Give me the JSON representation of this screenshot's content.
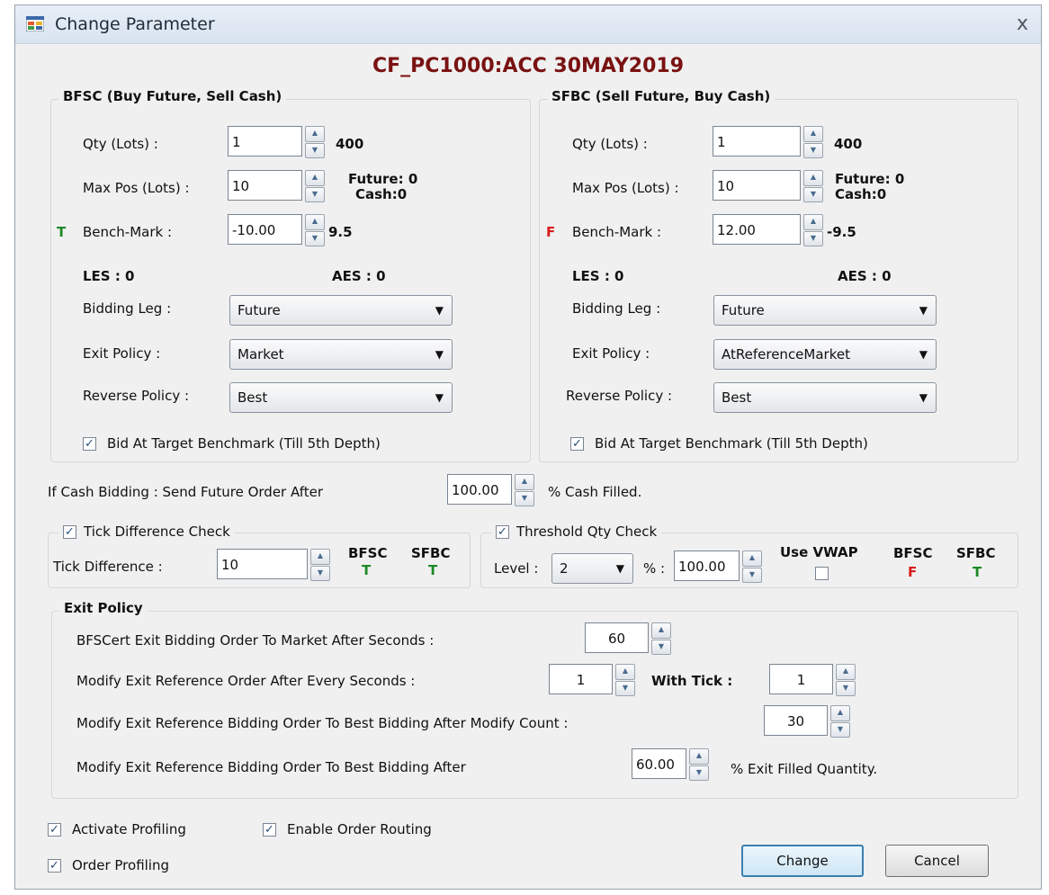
{
  "window": {
    "title": "Change Parameter",
    "close": "x"
  },
  "heading": "CF_PC1000:ACC 30MAY2019",
  "bfsc": {
    "legend": "BFSC (Buy Future, Sell Cash)",
    "qty_label": "Qty (Lots) :",
    "qty_value": "1",
    "qty_info": "400",
    "maxpos_label": "Max Pos (Lots) :",
    "maxpos_value": "10",
    "future_info": "Future: 0",
    "cash_info": "Cash:0",
    "flag": "T",
    "benchmark_label": "Bench-Mark :",
    "benchmark_value": "-10.00",
    "benchmark_info": "9.5",
    "les": "LES : 0",
    "aes": "AES : 0",
    "bidding_leg_label": "Bidding Leg :",
    "bidding_leg_value": "Future",
    "exit_policy_label": "Exit Policy :",
    "exit_policy_value": "Market",
    "reverse_policy_label": "Reverse Policy :",
    "reverse_policy_value": "Best",
    "bid_target_label": "Bid At Target Benchmark (Till 5th Depth)"
  },
  "sfbc": {
    "legend": "SFBC (Sell Future, Buy Cash)",
    "qty_label": "Qty (Lots) :",
    "qty_value": "1",
    "qty_info": "400",
    "maxpos_label": "Max Pos (Lots) :",
    "maxpos_value": "10",
    "future_info": "Future: 0",
    "cash_info": "Cash:0",
    "flag": "F",
    "benchmark_label": "Bench-Mark :",
    "benchmark_value": "12.00",
    "benchmark_info": "-9.5",
    "les": "LES : 0",
    "aes": "AES : 0",
    "bidding_leg_label": "Bidding Leg :",
    "bidding_leg_value": "Future",
    "exit_policy_label": "Exit Policy :",
    "exit_policy_value": "AtReferenceMarket",
    "reverse_policy_label": "Reverse Policy :",
    "reverse_policy_value": "Best",
    "bid_target_label": "Bid At Target Benchmark (Till 5th Depth)"
  },
  "cash_bidding": {
    "label": "If Cash Bidding : Send Future Order After",
    "value": "100.00",
    "suffix": "% Cash Filled."
  },
  "tick_check": {
    "legend": "Tick Difference Check",
    "label": "Tick Difference :",
    "value": "10",
    "bfsc_label": "BFSC",
    "sfbc_label": "SFBC",
    "bfsc_flag": "T",
    "sfbc_flag": "T"
  },
  "threshold_check": {
    "legend": "Threshold Qty Check",
    "level_label": "Level :",
    "level_value": "2",
    "pct_label": "% :",
    "pct_value": "100.00",
    "vwap_label": "Use VWAP",
    "bfsc_label": "BFSC",
    "sfbc_label": "SFBC",
    "bfsc_flag": "F",
    "sfbc_flag": "T"
  },
  "exit_policy": {
    "legend": "Exit Policy",
    "bfscert_label": "BFSCert Exit Bidding Order To Market After Seconds :",
    "bfscert_value": "60",
    "modify_every_label": "Modify Exit Reference Order After Every Seconds :",
    "modify_every_value": "1",
    "with_tick_label": "With Tick :",
    "with_tick_value": "1",
    "modify_count_label": "Modify Exit Reference Bidding Order To Best Bidding After Modify Count :",
    "modify_count_value": "30",
    "modify_after_label": "Modify Exit Reference Bidding Order To Best Bidding After",
    "modify_after_value": "60.00",
    "modify_after_suffix": "% Exit Filled Quantity."
  },
  "options": {
    "activate_profiling": "Activate Profiling",
    "enable_order_routing": "Enable Order Routing",
    "order_profiling": "Order Profiling"
  },
  "buttons": {
    "change": "Change",
    "cancel": "Cancel"
  },
  "colors": {
    "heading": "#7a1212",
    "flag_true": "#1d8a27",
    "flag_false": "#d91b1b"
  }
}
